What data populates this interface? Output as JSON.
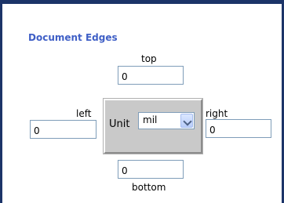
{
  "panel": {
    "title": "Document Edges"
  },
  "edges": {
    "top": {
      "label": "top",
      "value": "0"
    },
    "left": {
      "label": "left",
      "value": "0"
    },
    "right": {
      "label": "right",
      "value": "0"
    },
    "bottom": {
      "label": "bottom",
      "value": "0"
    }
  },
  "unit": {
    "label": "Unit",
    "selected": "mil"
  },
  "icons": {
    "dropdown": "chevron-down-icon"
  },
  "colors": {
    "frame": "#1c3468",
    "title": "#3f5fc6",
    "unit_panel": "#c9c9c9",
    "field_border": "#7f9db9",
    "dropdown_button": "#c8d8ff"
  }
}
